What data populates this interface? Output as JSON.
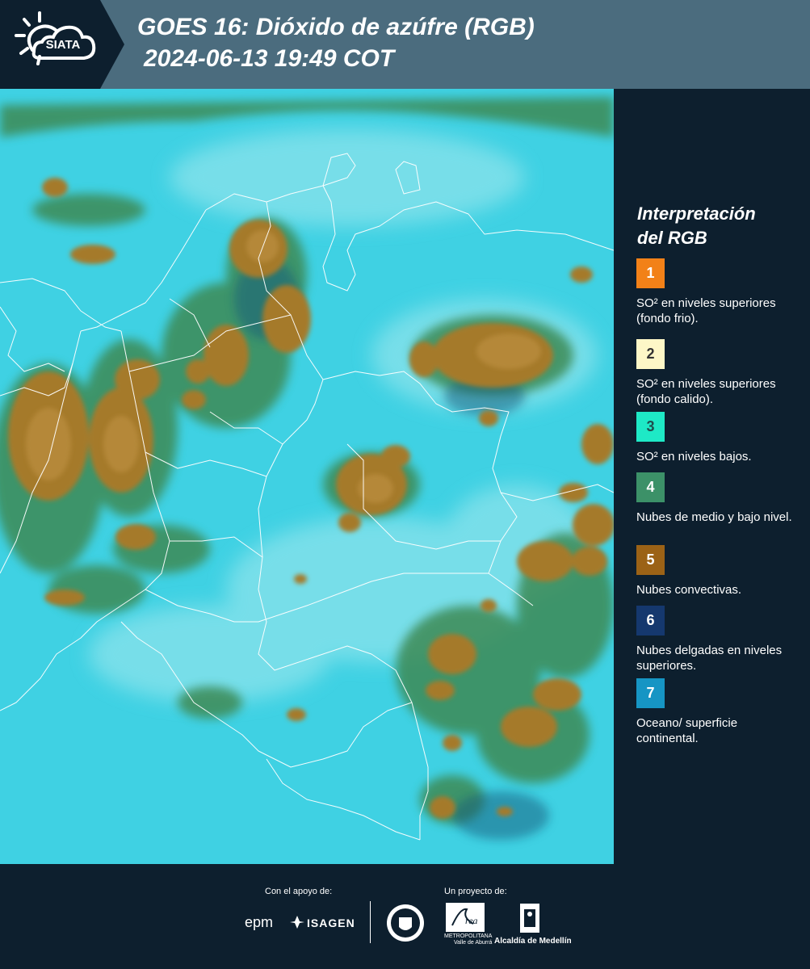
{
  "header": {
    "logo_text": "SIATA",
    "title": "GOES 16: Dióxido de azúfre (RGB)",
    "timestamp": "2024-06-13 19:49 COT"
  },
  "legend": {
    "title_line1": "Interpretación",
    "title_line2": "del RGB",
    "items": [
      {
        "number": "1",
        "label": "SO² en niveles superiores (fondo frio).",
        "color": "#f28118",
        "text_color": "#ffffff"
      },
      {
        "number": "2",
        "label": "SO² en niveles superiores (fondo calido).",
        "color": "#fdf7c7",
        "text_color": "#333333"
      },
      {
        "number": "3",
        "label": "SO² en niveles bajos.",
        "color": "#1ee9c6",
        "text_color": "#1f4d4d"
      },
      {
        "number": "4",
        "label": "Nubes de medio y bajo nivel.",
        "color": "#3c9168",
        "text_color": "#ffffff"
      },
      {
        "number": "5",
        "label": "Nubes convectivas.",
        "color": "#9b6216",
        "text_color": "#ffffff"
      },
      {
        "number": "6",
        "label": "Nubes delgadas en niveles superiores.",
        "color": "#15386e",
        "text_color": "#ffffff"
      },
      {
        "number": "7",
        "label": "Oceano/ superficie continental.",
        "color": "#1695c4",
        "text_color": "#ffffff"
      }
    ]
  },
  "footer": {
    "support_label": "Con el apoyo de:",
    "project_label": "Un proyecto de:",
    "sponsor1": "epm",
    "sponsor2": "ISAGEN",
    "partner1_sub": "METROPOLITANA",
    "partner1_sub2": "Valle de Aburrá",
    "partner2": "Alcaldía de Medellín"
  },
  "colors": {
    "background": "#0d1f2e",
    "header": "#4b6c7e",
    "map_base": "#3fd1e3",
    "cloud_convective": "#a57a2c",
    "cloud_low": "#3c8a55"
  }
}
